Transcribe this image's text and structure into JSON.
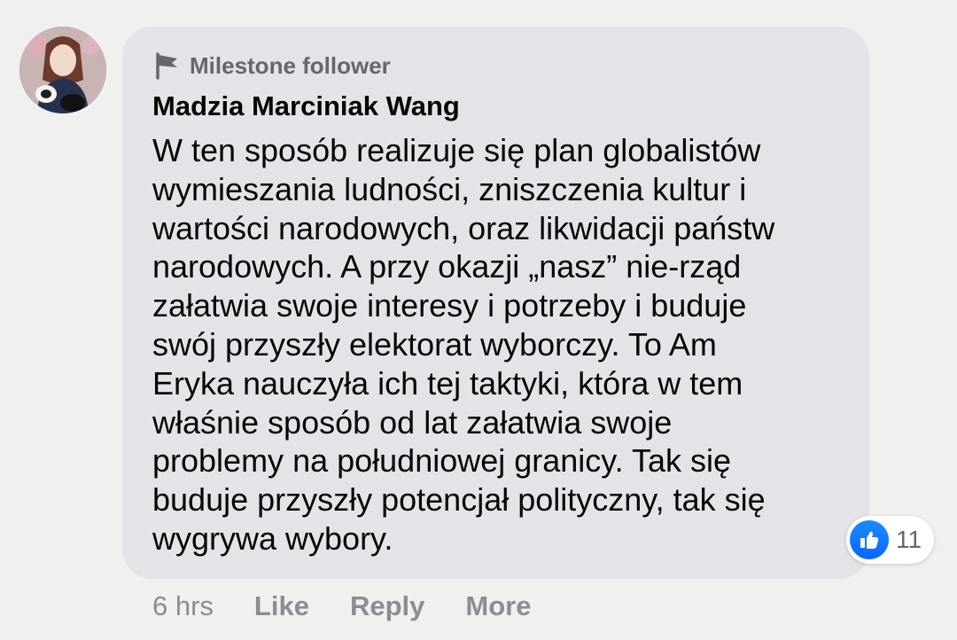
{
  "comment": {
    "badge": "Milestone follower",
    "author": "Madzia Marciniak Wang",
    "text": "W ten sposób realizuje się plan globalistów\nwymieszania ludności, zniszczenia kultur i\nwartości narodowych, oraz likwidacji państw\nnarodowych. A przy okazji „nasz” nie-rząd\nzałatwia swoje interesy i potrzeby i buduje\nswój przyszły elektorat wyborczy. To Am\nEryka nauczyła ich tej taktyki, która w tem\nwłaśnie sposób od lat załatwia swoje\nproblemy na południowej granicy. Tak się\nbuduje przyszły potencjał polityczny, tak się\nwygrywa wybory.",
    "reaction_count": "11",
    "time": "6 hrs"
  },
  "actions": {
    "like": "Like",
    "reply": "Reply",
    "more": "More"
  },
  "icons": {
    "badge": "flag-icon",
    "reaction": "thumbs-up-icon"
  },
  "colors": {
    "bubble": "#e3e4e8",
    "background": "#f0f0f0",
    "like_blue": "#0966ff",
    "secondary_text": "#65676b"
  }
}
